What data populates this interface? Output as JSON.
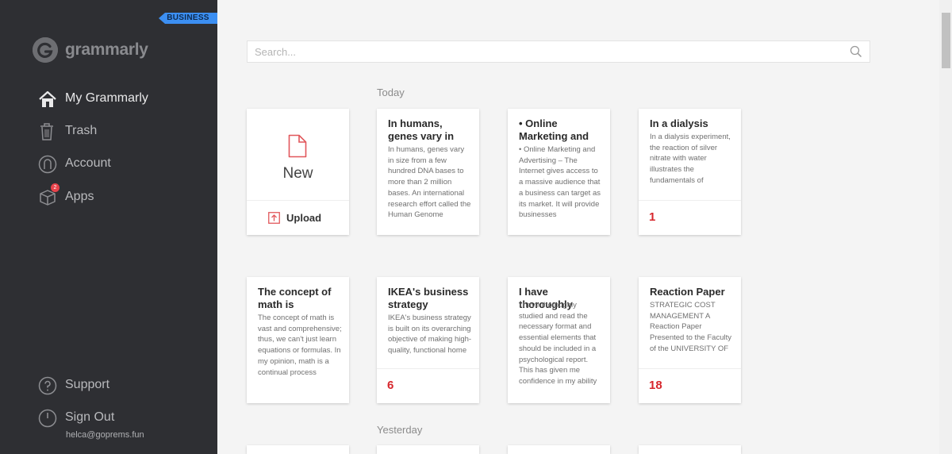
{
  "sidebar": {
    "badge": "BUSINESS",
    "logo_text": "grammarly",
    "nav": [
      {
        "label": "My Grammarly",
        "icon": "home-icon"
      },
      {
        "label": "Trash",
        "icon": "trash-icon"
      },
      {
        "label": "Account",
        "icon": "account-icon"
      },
      {
        "label": "Apps",
        "icon": "apps-icon",
        "badge_count": "2"
      }
    ],
    "bottom": [
      {
        "label": "Support",
        "icon": "question-icon"
      },
      {
        "label": "Sign Out",
        "icon": "power-icon"
      }
    ],
    "email": "helca@goprems.fun"
  },
  "search": {
    "placeholder": "Search..."
  },
  "sections": [
    "Today",
    "Yesterday"
  ],
  "new_card": {
    "new_label": "New",
    "upload_label": "Upload"
  },
  "documents": [
    {
      "title": "In humans, genes vary in",
      "preview": "In humans, genes vary in size from a few hundred DNA bases to more than 2 million bases. An international research effort called the Human Genome",
      "score": ""
    },
    {
      "title": "• Online Marketing and",
      "preview": "• Online Marketing and Advertising – The Internet gives access to a massive audience that a business can target as its market. It will provide businesses",
      "score": ""
    },
    {
      "title": "In a dialysis",
      "preview": "In a dialysis experiment, the reaction of silver nitrate with water illustrates the fundamentals of",
      "score": "1"
    },
    {
      "title": "The concept of math is",
      "preview": "The concept of math is vast and comprehensive; thus, we can't just learn equations or formulas. In my opinion, math is a continual process",
      "score": ""
    },
    {
      "title": "IKEA's business strategy",
      "preview": "IKEA's business strategy is built on its overarching objective of making high-quality, functional home",
      "score": "6"
    },
    {
      "title": "I have thoroughly",
      "preview": "I have thoroughly studied and read the necessary format and essential elements that should be included in a psychological report. This has given me confidence in my ability",
      "score": ""
    },
    {
      "title": "Reaction Paper",
      "preview": "STRATEGIC COST MANAGEMENT A Reaction Paper Presented to the Faculty of the UNIVERSITY OF",
      "score": "18"
    }
  ],
  "colors": {
    "sidebar": "#2e2f33",
    "accent": "#d7272d",
    "badge": "#3c8ff2"
  }
}
